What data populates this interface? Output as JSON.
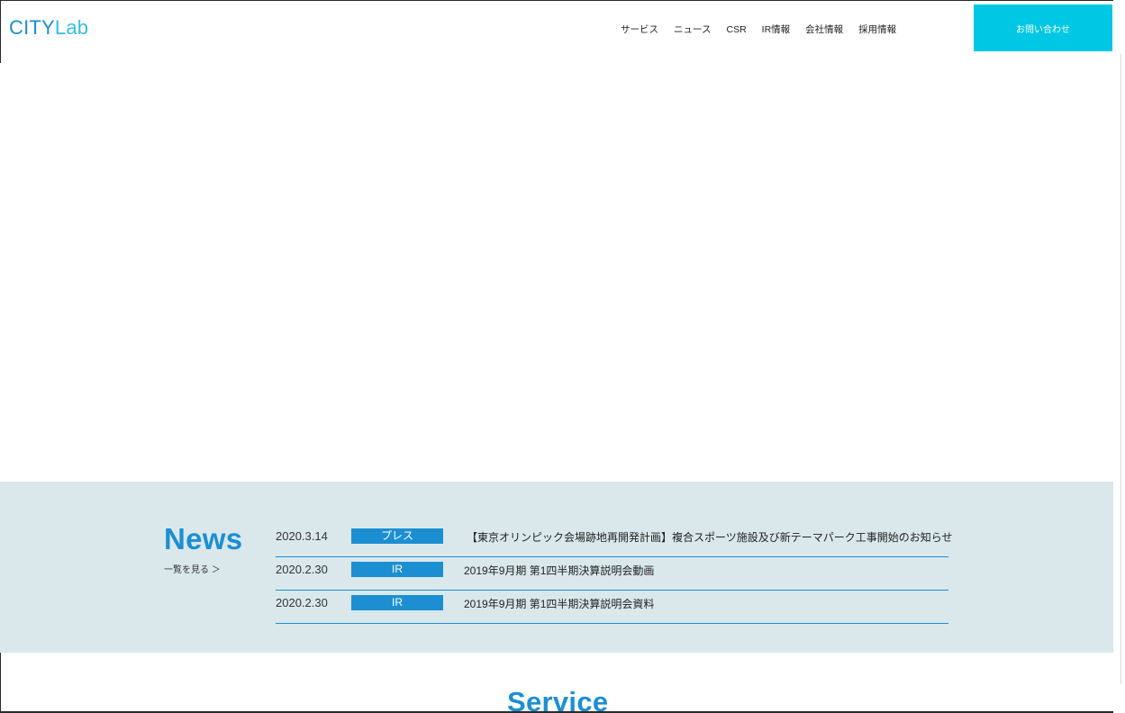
{
  "header": {
    "logo_part1": "CITY",
    "logo_part2": "Lab",
    "nav": [
      "サービス",
      "ニュース",
      "CSR",
      "IR情報",
      "会社情報",
      "採用情報"
    ],
    "contact_label": "お問い合わせ"
  },
  "news": {
    "title": "News",
    "more_label": "一覧を見る ＞",
    "items": [
      {
        "date": "2020.3.14",
        "tag": "プレス",
        "headline": "【東京オリンピック会場跡地再開発計画】複合スポーツ施設及び新テーマパーク工事開始のお知らせ"
      },
      {
        "date": "2020.2.30",
        "tag": "IR",
        "headline": "2019年9月期 第1四半期決算説明会動画"
      },
      {
        "date": "2020.2.30",
        "tag": "IR",
        "headline": "2019年9月期 第1四半期決算説明会資料"
      }
    ]
  },
  "service": {
    "title": "Service"
  },
  "colors": {
    "brand_blue": "#1c8fd2",
    "logo_light": "#34bde6",
    "contact_button": "#00c7e3",
    "news_background": "#dae8ec"
  }
}
